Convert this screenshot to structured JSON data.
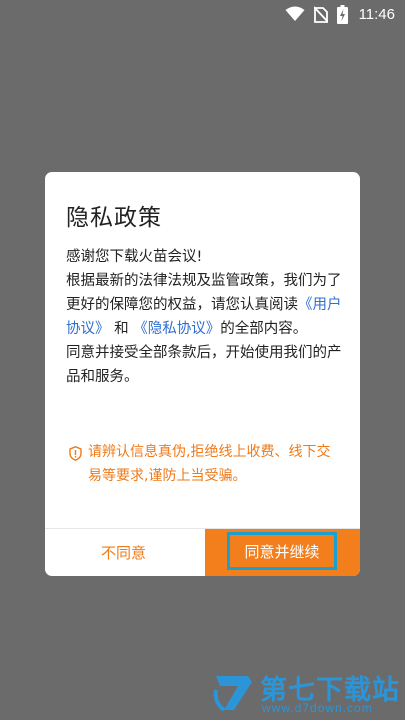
{
  "status_bar": {
    "time": "11:46",
    "icons": [
      "wifi-icon",
      "no-sim-icon",
      "battery-charging-icon"
    ]
  },
  "dialog": {
    "title": "隐私政策",
    "greeting": "感谢您下载火苗会议!",
    "text_1": "根据最新的法律法规及监管政策，我们为了更好的保障您的权益，请您认真阅读",
    "link_user_agreement": "《用户协议》",
    "text_and": " 和 ",
    "link_privacy_agreement": "《隐私协议》",
    "text_2": "的全部内容。",
    "text_3": "同意并接受全部条款后，开始使用我们的产品和服务。",
    "notice": "请辨认信息真伪,拒绝线上收费、线下交易等要求,谨防上当受骗。",
    "notice_icon": "shield-alert-icon",
    "decline_label": "不同意",
    "accept_label": "同意并继续",
    "colors": {
      "accent": "#f37e1c",
      "link": "#2e6fd2",
      "highlight": "#1aa0d0"
    }
  },
  "watermark": {
    "title": "第七下载站",
    "url": "www.d7down.com"
  }
}
